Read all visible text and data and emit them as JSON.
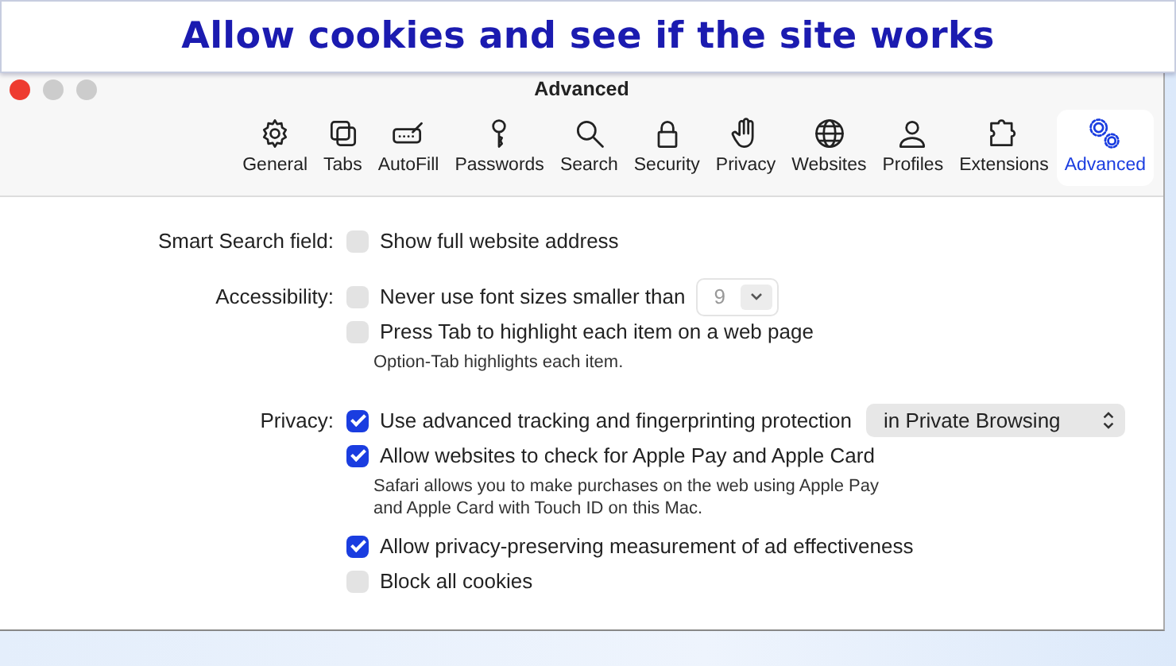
{
  "caption": "Allow cookies and see if the site works",
  "window": {
    "title": "Advanced"
  },
  "toolbar": [
    {
      "label": "General",
      "selected": false
    },
    {
      "label": "Tabs",
      "selected": false
    },
    {
      "label": "AutoFill",
      "selected": false
    },
    {
      "label": "Passwords",
      "selected": false
    },
    {
      "label": "Search",
      "selected": false
    },
    {
      "label": "Security",
      "selected": false
    },
    {
      "label": "Privacy",
      "selected": false
    },
    {
      "label": "Websites",
      "selected": false
    },
    {
      "label": "Profiles",
      "selected": false
    },
    {
      "label": "Extensions",
      "selected": false
    },
    {
      "label": "Advanced",
      "selected": true
    }
  ],
  "sections": [
    {
      "label": "Smart Search field:",
      "rows": [
        {
          "kind": "checkbox",
          "label": "Show full website address",
          "checked": false
        }
      ]
    },
    {
      "label": "Accessibility:",
      "rows": [
        {
          "kind": "checkbox",
          "label": "Never use font sizes smaller than",
          "checked": false,
          "popup": {
            "value": "9",
            "disabled": true
          }
        },
        {
          "kind": "checkbox",
          "label": "Press Tab to highlight each item on a web page",
          "checked": false
        },
        {
          "kind": "hint",
          "text": "Option-Tab highlights each item."
        }
      ]
    },
    {
      "label": "Privacy:",
      "rows": [
        {
          "kind": "checkbox",
          "label": "Use advanced tracking and fingerprinting protection",
          "checked": true,
          "popup": {
            "value": "in Private Browsing",
            "disabled": false
          }
        },
        {
          "kind": "checkbox",
          "label": "Allow websites to check for Apple Pay and Apple Card",
          "checked": true
        },
        {
          "kind": "hint",
          "text": "Safari allows you to make purchases on the web using Apple Pay and Apple Card with Touch ID on this Mac."
        },
        {
          "kind": "checkbox",
          "label": "Allow privacy-preserving measurement of ad effectiveness",
          "checked": true
        },
        {
          "kind": "checkbox",
          "label": "Block all cookies",
          "checked": false
        }
      ]
    }
  ]
}
